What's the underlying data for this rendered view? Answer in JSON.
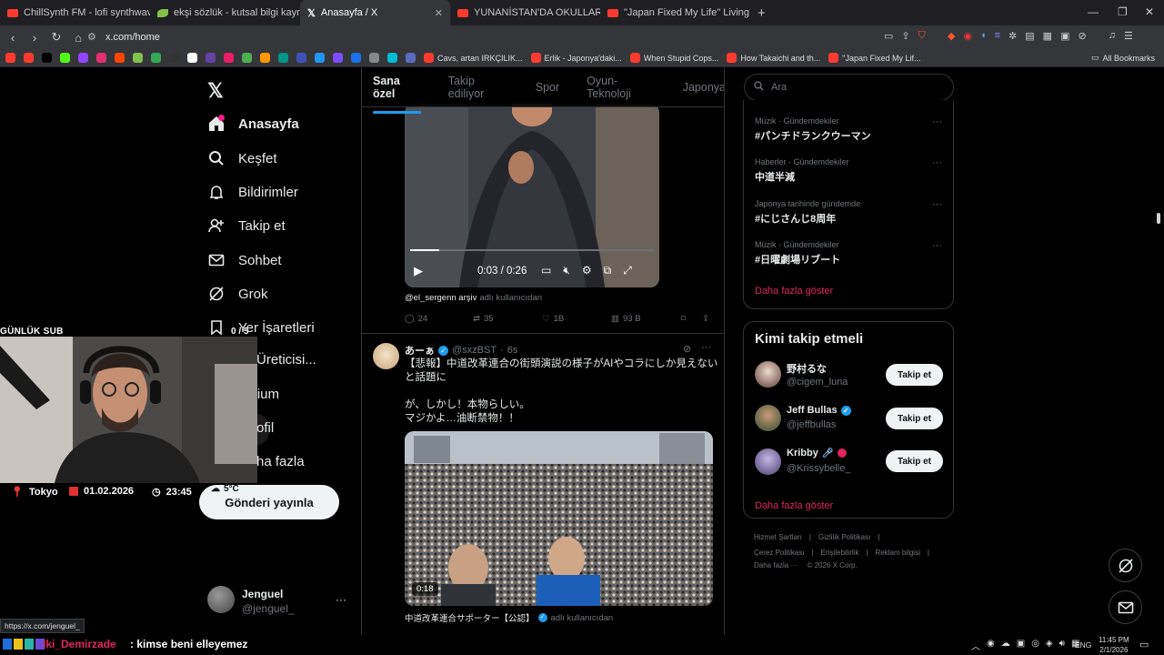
{
  "browser": {
    "tabs": [
      {
        "title": "ChillSynth FM - lofi synthwave ra",
        "color": "#ff3b30"
      },
      {
        "title": "ekşi sözlük - kutsal bilgi kaynağı",
        "color": "#81c14b"
      },
      {
        "title": "Anasayfa / X",
        "color": "#ffffff"
      },
      {
        "title": "YUNANİSTAN'DA OKULLARDA TÜRK",
        "color": "#ff3b30"
      },
      {
        "title": "\"Japan Fixed My Life\" Living in Japan",
        "color": "#ff3b30"
      }
    ],
    "url": "x.com/home",
    "bookmarks": [
      {
        "label": "Cavs, artan IRKÇILIK..."
      },
      {
        "label": "Erlik - Japonya'daki..."
      },
      {
        "label": "When Stupid Cops..."
      },
      {
        "label": "How Takaichi and th..."
      },
      {
        "label": "\"Japan Fixed My Lif..."
      }
    ],
    "all_bookmarks": "All Bookmarks",
    "status_url": "https://x.com/jenguel_"
  },
  "nav": {
    "items": [
      {
        "label": "Anasayfa",
        "icon": "home-icon"
      },
      {
        "label": "Keşfet",
        "icon": "search-icon"
      },
      {
        "label": "Bildirimler",
        "icon": "bell-icon"
      },
      {
        "label": "Takip et",
        "icon": "add-user-icon"
      },
      {
        "label": "Sohbet",
        "icon": "mail-icon"
      },
      {
        "label": "Grok",
        "icon": "grok-icon"
      },
      {
        "label": "Yer İşaretleri",
        "icon": "bookmark-icon"
      },
      {
        "label": "rik Üreticisi...",
        "icon": ""
      },
      {
        "label": "emium",
        "icon": ""
      },
      {
        "label": "ofil",
        "icon": ""
      },
      {
        "label": "ha fazla",
        "icon": ""
      }
    ],
    "post_button": "Gönderi yayınla",
    "account": {
      "name": "Jenguel",
      "handle": "@jenguel_"
    }
  },
  "feed": {
    "tabs": [
      "Sana özel",
      "Takip ediliyor",
      "Spor",
      "Oyun-Teknoloji",
      "Japonya"
    ],
    "tweet1": {
      "video_time": "0:03 / 0:26",
      "attribution_user": "@el_sergenn arşiv",
      "attribution_suffix": "adlı kullanıcıdan",
      "replies": "24",
      "reposts": "35",
      "likes": "1B",
      "views": "93 B"
    },
    "tweet2": {
      "name": "あーぁ",
      "handle": "@sxzBST",
      "time": "6s",
      "text_line1": "【悲報】中道改革連合の街頭演説の様子がAIやコラにしか見えないと話題に",
      "text_line2": "が、しかし！本物らしい。",
      "text_line3": "マジかよ…油断禁物！！",
      "video_duration": "0:18",
      "attribution_user": "中道改革連合サポーター【公認】",
      "attribution_suffix": "adlı kullanıcıdan"
    }
  },
  "right": {
    "search_placeholder": "Ara",
    "trends": [
      {
        "category": "Müzik · Gündemdekiler",
        "name": "#パンチドランクウーマン"
      },
      {
        "category": "Haberler · Gündemdekiler",
        "name": "中道半減"
      },
      {
        "category": "Japonya tarihinde gündemde",
        "name": "#にじさんじ8周年"
      },
      {
        "category": "Müzik · Gündemdekiler",
        "name": "#日曜劇場リブート"
      }
    ],
    "show_more": "Daha fazla göster",
    "who_to_follow_title": "Kimi takip etmeli",
    "follow_suggestions": [
      {
        "name": "野村るな",
        "handle": "@cigem_luna",
        "button": "Takip et"
      },
      {
        "name": "Jeff Bullas",
        "handle": "@jeffbullas",
        "button": "Takip et"
      },
      {
        "name": "Kribby",
        "handle": "@Krissybelle_",
        "button": "Takip et"
      }
    ],
    "show_more_2": "Daha fazla göster",
    "footer": {
      "terms": "Hizmet Şartları",
      "privacy": "Gizlilik Politikası",
      "cookies": "Çerez Politikası",
      "accessibility": "Erişilebilirlik",
      "ads": "Reklam bilgisi",
      "more": "Daha fazla ···",
      "copyright": "© 2026 X Corp."
    }
  },
  "stream_overlay": {
    "sub_label": "GÜNLÜK SUB",
    "sub_count": "0 / 5",
    "location": "Tokyo",
    "date": "01.02.2026",
    "time": "23:45",
    "weather": "5°C",
    "chat_user": "Iki_Demirzade",
    "chat_message": ": kimse beni elleyemez"
  },
  "taskbar": {
    "lang": "ENG",
    "clock_time": "11:45 PM",
    "clock_date": "2/1/2026"
  }
}
